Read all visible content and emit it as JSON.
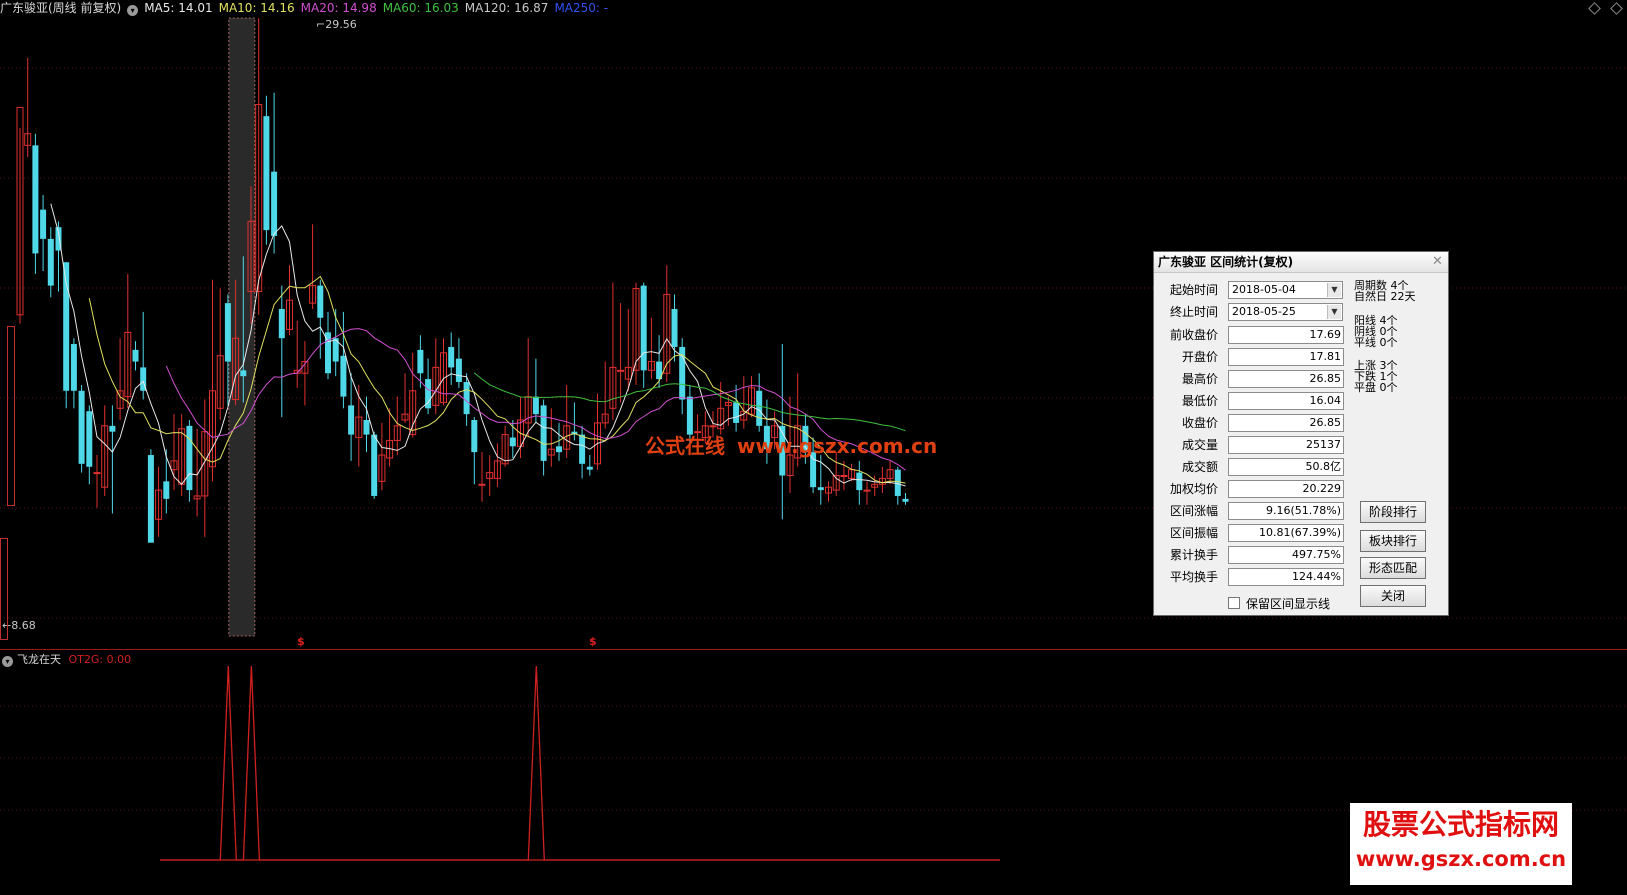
{
  "header": {
    "title": "广东骏亚(周线 前复权)",
    "ma5": "MA5: 14.01",
    "ma10": "MA10: 14.16",
    "ma20": "MA20: 14.98",
    "ma60": "MA60: 16.03",
    "ma120": "MA120: 16.87",
    "ma250": "MA250: -"
  },
  "price_labels": {
    "high": "29.56",
    "low": "8.68"
  },
  "signal_marks": [
    "$",
    "$"
  ],
  "indicator": {
    "name": "飞龙在天",
    "value": "OT2G: 0.00"
  },
  "watermark": {
    "cn": "公式在线",
    "url": "www.gszx.com.cn"
  },
  "brand": {
    "line1": "股票公式指标网",
    "line2": "www.gszx.com.cn"
  },
  "colors": {
    "up": "#e03030",
    "down": "#4fd8e8",
    "ma5": "#e8e8e8",
    "ma10": "#e0e060",
    "ma20": "#d050d0",
    "ma60": "#40c040",
    "ma120": "#b0b0b0",
    "ma250": "#3050f0",
    "indicator": "#d02020"
  },
  "dialog": {
    "title": "广东骏亚 区间统计(复权)",
    "fields": [
      {
        "label": "起始时间",
        "value": "2018-05-04"
      },
      {
        "label": "终止时间",
        "value": "2018-05-25"
      },
      {
        "label": "前收盘价",
        "value": "17.69"
      },
      {
        "label": "开盘价",
        "value": "17.81"
      },
      {
        "label": "最高价",
        "value": "26.85"
      },
      {
        "label": "最低价",
        "value": "16.04"
      },
      {
        "label": "收盘价",
        "value": "26.85"
      },
      {
        "label": "成交量",
        "value": "25137"
      },
      {
        "label": "成交额",
        "value": "50.8亿"
      },
      {
        "label": "加权均价",
        "value": "20.229"
      },
      {
        "label": "区间涨幅",
        "value": "9.16(51.78%)"
      },
      {
        "label": "区间振幅",
        "value": "10.81(67.39%)"
      },
      {
        "label": "累计换手",
        "value": "497.75%"
      },
      {
        "label": "平均换手",
        "value": "124.44%"
      }
    ],
    "stats": {
      "period_label": "周期数",
      "period_value": "4个",
      "natural_label": "自然日",
      "natural_value": "22天",
      "yang_label": "阳线",
      "yang_value": "4个",
      "yin_label": "阴线",
      "yin_value": "0个",
      "flat_label": "平线",
      "flat_value": "0个",
      "up_label": "上涨",
      "up_value": "3个",
      "down_label": "下跌",
      "down_value": "1个",
      "even_label": "平盘",
      "even_value": "0个"
    },
    "buttons": {
      "rank_stage": "阶段排行",
      "rank_sector": "板块排行",
      "pattern": "形态匹配",
      "close": "关闭"
    },
    "checkbox": "保留区间显示线"
  },
  "chart_data": {
    "type": "candlestick",
    "price_range": [
      8.68,
      29.56
    ],
    "candles": [
      [
        19.4,
        26.5,
        25.8,
        19.1
      ],
      [
        25.2,
        25.6,
        28.2,
        24.8
      ],
      [
        25.2,
        21.5,
        25.6,
        20.8
      ],
      [
        23,
        22,
        23.5,
        20.9
      ],
      [
        22,
        20.4,
        22.4,
        20
      ],
      [
        22.4,
        21.6,
        22.6,
        20.2
      ],
      [
        21.2,
        16.8,
        21.2,
        16.2
      ],
      [
        18.4,
        16.8,
        18.6,
        16.2
      ],
      [
        16.8,
        14.3,
        17,
        14
      ],
      [
        16.1,
        14.2,
        16.3,
        13.6
      ],
      [
        14,
        14,
        14.6,
        12.8
      ],
      [
        13.5,
        15.6,
        16.3,
        13.2
      ],
      [
        15.6,
        15.4,
        16.3,
        12.6
      ],
      [
        16.2,
        16.8,
        18.6,
        15.8
      ],
      [
        16.6,
        18.8,
        20.8,
        16.2
      ],
      [
        18.2,
        17.8,
        18.5,
        17.5
      ],
      [
        17.6,
        16.8,
        19.5,
        16.5
      ],
      [
        14.6,
        11.6,
        14.8,
        11.6
      ],
      [
        12.4,
        13.4,
        14.2,
        11.8
      ],
      [
        13.7,
        13.1,
        14.8,
        12.6
      ],
      [
        14.1,
        14.4,
        16,
        13.4
      ],
      [
        13.6,
        15.5,
        16,
        13.2
      ],
      [
        15.6,
        13.4,
        15.8,
        13
      ],
      [
        13.1,
        13.2,
        15.5,
        12.5
      ],
      [
        13.2,
        15.4,
        16.5,
        11.8
      ],
      [
        14.2,
        16.8,
        20.6,
        13.7
      ],
      [
        16.2,
        18,
        20.3,
        15.8
      ],
      [
        19.8,
        17.8,
        20.1,
        16.3
      ],
      [
        16.5,
        18.6,
        20.6,
        16.3
      ],
      [
        17.5,
        17.3,
        21.4,
        16.4
      ],
      [
        20.2,
        22.6,
        23.8,
        19.1
      ],
      [
        20.2,
        26.6,
        29.56,
        19.4
      ],
      [
        26.2,
        22.3,
        26.9,
        21.8
      ],
      [
        24.3,
        22.1,
        27,
        21.5
      ],
      [
        19.6,
        18.6,
        20.4,
        15.9
      ],
      [
        18.9,
        19.9,
        21.1,
        18.7
      ],
      [
        17.4,
        17.5,
        19.2,
        16.9
      ],
      [
        17.4,
        17.8,
        18.5,
        16.3
      ],
      [
        19.8,
        20.4,
        22.5,
        19.6
      ],
      [
        20.4,
        19.3,
        20.6,
        17.9
      ],
      [
        18.8,
        17.4,
        19.5,
        17.2
      ],
      [
        18.6,
        17.8,
        19.6,
        17.3
      ],
      [
        18,
        16.6,
        19.5,
        16.2
      ],
      [
        16.3,
        15.3,
        17.4,
        14.4
      ],
      [
        15.2,
        15.9,
        17,
        14.2
      ],
      [
        15.8,
        15.3,
        16.6,
        14.7
      ],
      [
        15.3,
        13.2,
        15.4,
        13.1
      ],
      [
        13.7,
        14.6,
        15.7,
        13.4
      ],
      [
        14.5,
        15.1,
        16.2,
        14.2
      ],
      [
        15.1,
        15.6,
        16.6,
        14.6
      ],
      [
        15.8,
        16,
        17.4,
        15.7
      ],
      [
        15.3,
        16.8,
        18.1,
        15.2
      ],
      [
        18.2,
        17.4,
        18.7,
        16.9
      ],
      [
        17.2,
        16.2,
        17.9,
        16
      ],
      [
        16.3,
        17.6,
        18.6,
        16
      ],
      [
        16.4,
        18.1,
        18.6,
        16.3
      ],
      [
        18.3,
        17.6,
        18.8,
        17
      ],
      [
        17.9,
        17.1,
        18.6,
        16.9
      ],
      [
        17.1,
        16,
        17.4,
        15.6
      ],
      [
        15.8,
        14.7,
        15.9,
        13.6
      ],
      [
        13.6,
        13.6,
        14.7,
        13
      ],
      [
        13.8,
        14,
        14.6,
        13.2
      ],
      [
        13.8,
        14.4,
        15,
        13.5
      ],
      [
        14.3,
        15.3,
        15.6,
        14.2
      ],
      [
        15.2,
        14.9,
        15.8,
        14.5
      ],
      [
        14.9,
        15.8,
        16.6,
        14.5
      ],
      [
        15.7,
        16.6,
        18.6,
        15.2
      ],
      [
        16.6,
        16,
        17.9,
        15.7
      ],
      [
        16.3,
        14.4,
        16.5,
        13.9
      ],
      [
        14.6,
        14.8,
        16.2,
        14.2
      ],
      [
        14.9,
        14.7,
        15.7,
        14.4
      ],
      [
        14.8,
        15.6,
        17,
        14.5
      ],
      [
        15.4,
        15.3,
        16.4,
        15.1
      ],
      [
        15.3,
        14.3,
        15.6,
        13.8
      ],
      [
        14.2,
        14.1,
        14.6,
        13.9
      ],
      [
        14.3,
        15.7,
        16.7,
        14.1
      ],
      [
        15.7,
        16,
        17.8,
        15.5
      ],
      [
        16.2,
        17.6,
        20.5,
        15.8
      ],
      [
        17.5,
        17.5,
        19.8,
        16.4
      ],
      [
        17.2,
        17.6,
        19.6,
        16.8
      ],
      [
        17.5,
        20.3,
        20.5,
        17
      ],
      [
        20.4,
        17.5,
        20.5,
        16.9
      ],
      [
        17.5,
        17.8,
        19.3,
        17.2
      ],
      [
        17.8,
        17.2,
        18.7,
        16.9
      ],
      [
        17.4,
        20.1,
        21.1,
        17.1
      ],
      [
        19.6,
        18.3,
        20.1,
        17.8
      ],
      [
        18.3,
        16.5,
        18.6,
        16
      ],
      [
        16.6,
        15.3,
        17,
        14.9
      ],
      [
        15.4,
        15.4,
        16,
        14.8
      ],
      [
        15.2,
        15.6,
        16.1,
        15
      ],
      [
        15.6,
        15.6,
        16.1,
        15.2
      ],
      [
        15.5,
        16.2,
        17.1,
        15.3
      ],
      [
        16.3,
        16.4,
        16.6,
        15.6
      ],
      [
        16.4,
        15.7,
        17,
        15.4
      ],
      [
        15.8,
        16.1,
        17.3,
        15.5
      ],
      [
        16,
        16.9,
        17.3,
        15.9
      ],
      [
        16.8,
        15.6,
        17.4,
        15.4
      ],
      [
        15.6,
        14.8,
        16.5,
        14.3
      ],
      [
        15.2,
        15.6,
        16.1,
        14.8
      ],
      [
        15.6,
        13.9,
        18.4,
        12.4
      ],
      [
        13.9,
        14.6,
        16.6,
        13.3
      ],
      [
        14.5,
        15.6,
        17.4,
        14.2
      ],
      [
        15.6,
        14.7,
        16,
        14.3
      ],
      [
        14.7,
        13.5,
        15.2,
        13.3
      ],
      [
        13.5,
        13.4,
        14.6,
        12.9
      ],
      [
        13.3,
        13.5,
        13.7,
        13
      ],
      [
        13.4,
        13.9,
        14.7,
        13.2
      ],
      [
        13.9,
        13.9,
        14.4,
        13.4
      ],
      [
        13.8,
        14.1,
        14.3,
        13.7
      ],
      [
        14,
        13.4,
        14.4,
        12.9
      ],
      [
        13.4,
        13.4,
        13.7,
        12.9
      ],
      [
        13.5,
        13.6,
        13.9,
        13.2
      ],
      [
        13.6,
        13.8,
        14.2,
        13.3
      ],
      [
        13.8,
        14.1,
        14.4,
        13.6
      ],
      [
        14.1,
        13.2,
        14.2,
        12.9
      ],
      [
        13.1,
        13,
        13.3,
        12.9
      ]
    ],
    "ma_series": [
      {
        "name": "MA5",
        "window": 5
      },
      {
        "name": "MA10",
        "window": 10
      },
      {
        "name": "MA20",
        "window": 20
      },
      {
        "name": "MA60",
        "window": 60
      }
    ],
    "indicator_spikes": [
      19,
      22,
      59
    ],
    "highlight_index": 24
  }
}
